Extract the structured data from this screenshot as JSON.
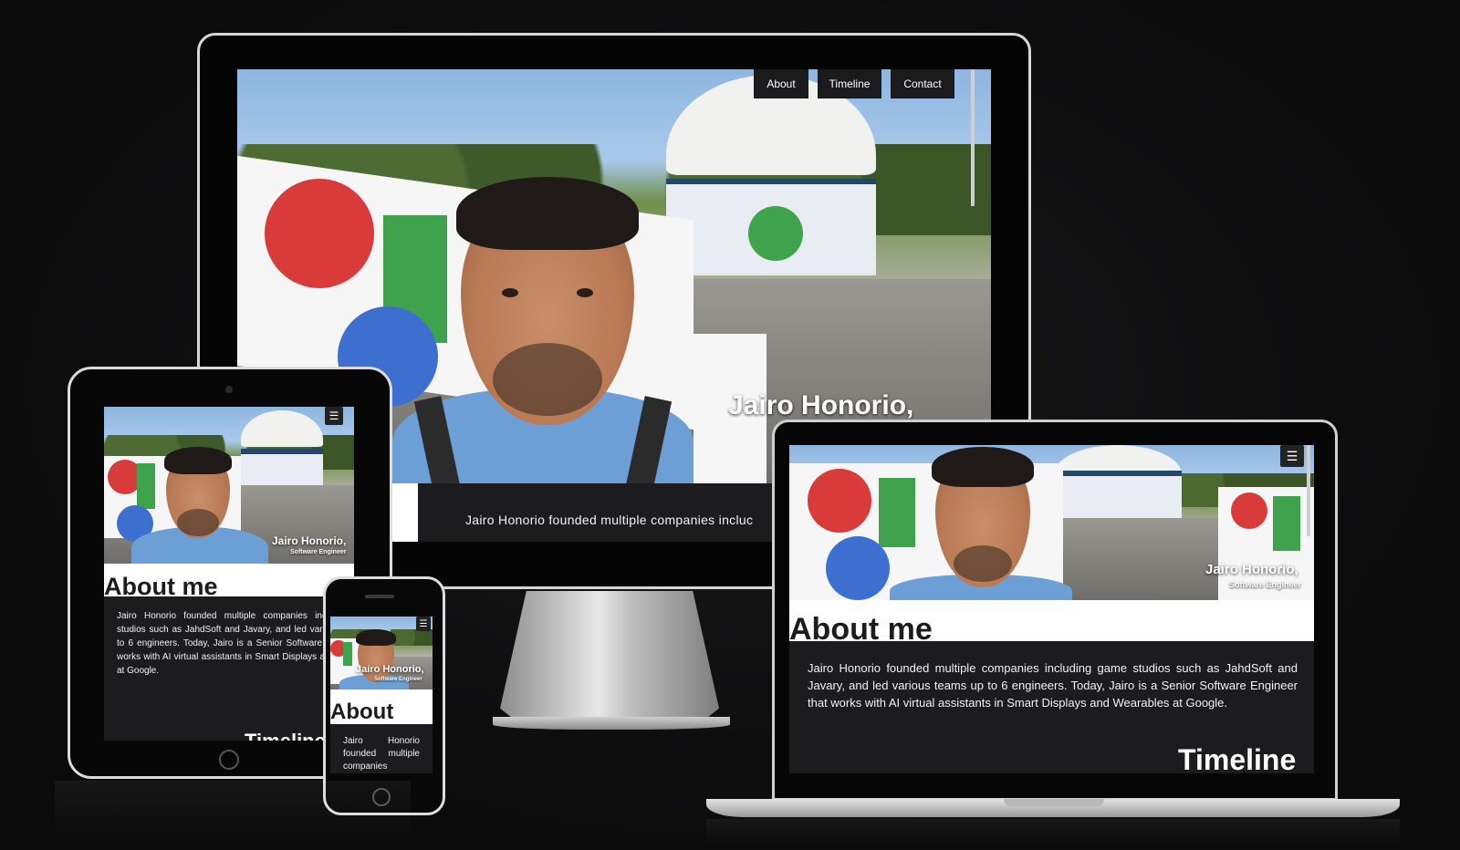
{
  "site": {
    "name": "Jairo Honorio,",
    "role": "Software Engineer",
    "nav": [
      "About",
      "Timeline",
      "Contact"
    ],
    "menu_icon": "hamburger-icon",
    "about_heading": "About me",
    "about_heading_short": "About",
    "about_text": "Jairo Honorio founded multiple companies including game studios such as JahdSoft and Javary, and led various teams up to 6 engineers. Today, Jairo is a Senior Software Engineer that works with AI virtual assistants in Smart Displays and Wearables at Google.",
    "about_text_desktop_visible": "Jairo Honorio founded multiple companies incluc",
    "about_text_phone_visible": "Jairo Honorio founded multiple companies",
    "timeline_heading": "Timeline",
    "timeline_heading_partial": "Timeli"
  },
  "colors": {
    "background": "#0b0b0c",
    "dark_panel": "#1c1c1e",
    "nav_button": "#1b1b1d",
    "heading_text": "#1c1c1c"
  }
}
